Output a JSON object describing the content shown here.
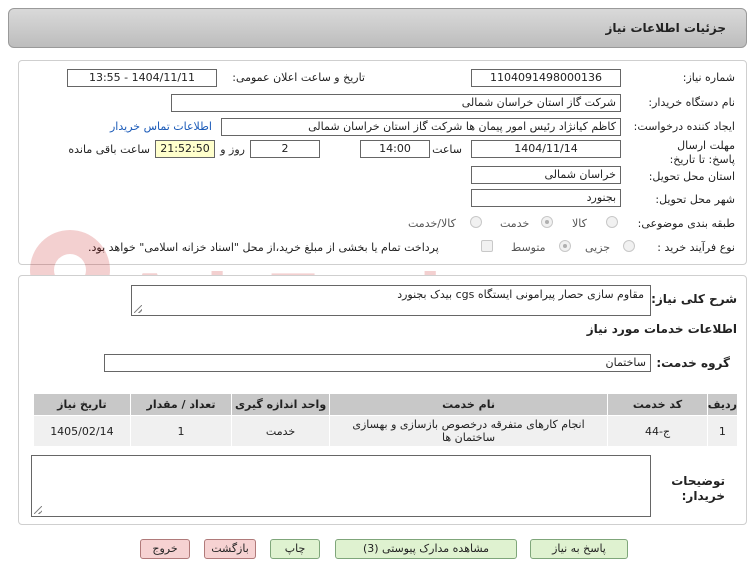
{
  "header": {
    "title": "جزئیات اطلاعات نیاز"
  },
  "fields": {
    "need_number_label": "شماره نیاز:",
    "need_number": "1104091498000136",
    "announce_label": "تاریخ و ساعت اعلان عمومی:",
    "announce_value": "1404/11/11 - 13:55",
    "buyer_label": "نام دستگاه خریدار:",
    "buyer_value": "شرکت گاز استان خراسان شمالی",
    "requester_label": "ایجاد کننده درخواست:",
    "requester_value": "کاظم کیانژاد رئیس امور پیمان ها شرکت گاز استان خراسان شمالی",
    "contact_link": "اطلاعات تماس خریدار",
    "deadline_label": "مهلت ارسال پاسخ: تا تاریخ:",
    "deadline_date": "1404/11/14",
    "time_label": "ساعت",
    "deadline_time": "14:00",
    "days_value": "2",
    "days_label": "روز و",
    "remaining_time": "21:52:50",
    "remaining_label": "ساعت باقی مانده",
    "province_label": "استان محل تحویل:",
    "province_value": "خراسان شمالی",
    "city_label": "شهر محل تحویل:",
    "city_value": "بجنورد",
    "category_label": "طبقه بندی موضوعی:",
    "category_options": [
      "کالا",
      "خدمت",
      "کالا/خدمت"
    ],
    "process_label": "نوع فرآیند خرید :",
    "process_options": [
      "جزیی",
      "متوسط"
    ],
    "payment_note": "پرداخت تمام یا بخشی از مبلغ خرید،از محل \"اسناد خزانه اسلامی\" خواهد بود."
  },
  "description": {
    "label": "شرح کلی نیاز:",
    "value": "مقاوم سازی حصار پیرامونی ایستگاه cgs بیدک بجنورد"
  },
  "services": {
    "section_title": "اطلاعات خدمات مورد نیاز",
    "group_label": "گروه خدمت:",
    "group_value": "ساختمان",
    "columns": [
      "ردیف",
      "کد خدمت",
      "نام خدمت",
      "واحد اندازه گیری",
      "تعداد / مقدار",
      "تاریخ نیاز"
    ],
    "rows": [
      [
        "1",
        "ج-44",
        "انجام کارهای متفرقه درخصوص بازسازی و بهسازی ساختمان ها",
        "خدمت",
        "1",
        "1405/02/14"
      ]
    ]
  },
  "notes": {
    "label": "توضیحات خریدار:",
    "value": ""
  },
  "buttons": {
    "reply": "پاسخ به نیاز",
    "attachments": "مشاهده مدارک پیوستی (3)",
    "print": "چاپ",
    "back": "بازگشت",
    "exit": "خروج"
  },
  "watermark": {
    "text": "AriaTender.net"
  },
  "colors": {
    "header_bg": "#c9c9c9",
    "highlight": "#ffffcc",
    "link": "#1a5ab8",
    "green_btn": "#dff2d0",
    "red_btn": "#f6d2d2"
  }
}
